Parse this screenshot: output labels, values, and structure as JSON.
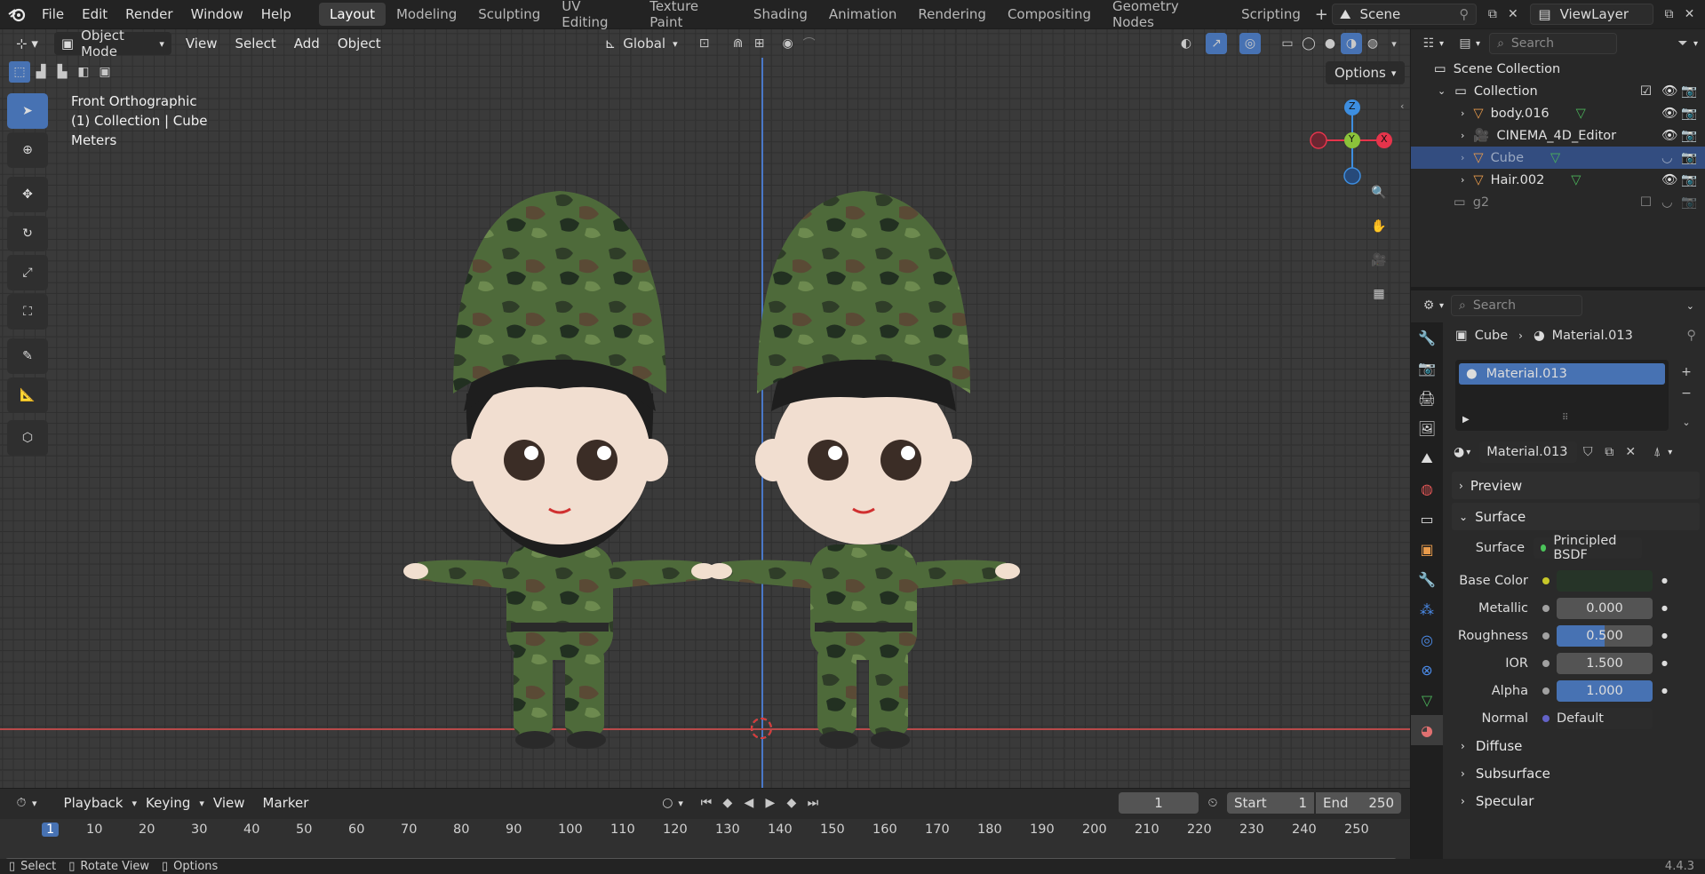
{
  "menu": {
    "file": "File",
    "edit": "Edit",
    "render": "Render",
    "window": "Window",
    "help": "Help"
  },
  "workspaces": [
    "Layout",
    "Modeling",
    "Sculpting",
    "UV Editing",
    "Texture Paint",
    "Shading",
    "Animation",
    "Rendering",
    "Compositing",
    "Geometry Nodes",
    "Scripting"
  ],
  "scene": {
    "label": "Scene",
    "view_layer": "ViewLayer"
  },
  "viewport": {
    "mode": "Object Mode",
    "view": "View",
    "select": "Select",
    "add": "Add",
    "object": "Object",
    "orientation": "Global",
    "options": "Options",
    "overlay_line1": "Front Orthographic",
    "overlay_line2": "(1) Collection | Cube",
    "overlay_line3": "Meters",
    "gizmo": {
      "z": "Z",
      "y": "Y",
      "x": "X"
    }
  },
  "outliner": {
    "search_placeholder": "Search",
    "scene_collection": "Scene Collection",
    "items": [
      {
        "name": "Collection"
      },
      {
        "name": "body.016"
      },
      {
        "name": "CINEMA_4D_Editor"
      },
      {
        "name": "Cube"
      },
      {
        "name": "Hair.002"
      },
      {
        "name": "g2"
      }
    ]
  },
  "properties": {
    "search_placeholder": "Search",
    "breadcrumb_object": "Cube",
    "breadcrumb_material": "Material.013",
    "slot": "Material.013",
    "material_name": "Material.013",
    "sections": {
      "preview": "Preview",
      "surface": "Surface",
      "diffuse": "Diffuse",
      "subsurface": "Subsurface",
      "specular": "Specular"
    },
    "surface_label": "Surface",
    "surface_shader": "Principled BSDF",
    "base_color_label": "Base Color",
    "base_color": "#263428",
    "metallic_label": "Metallic",
    "metallic": "0.000",
    "metallic_value": 0.0,
    "roughness_label": "Roughness",
    "roughness": "0.500",
    "roughness_value": 0.5,
    "ior_label": "IOR",
    "ior": "1.500",
    "ior_value": 0.0,
    "alpha_label": "Alpha",
    "alpha": "1.000",
    "alpha_value": 1.0,
    "normal_label": "Normal",
    "normal": "Default"
  },
  "timeline": {
    "playback": "Playback",
    "keying": "Keying",
    "view": "View",
    "marker": "Marker",
    "current_frame": "1",
    "start_label": "Start",
    "start": "1",
    "end_label": "End",
    "end": "250",
    "ruler": [
      "1",
      "10",
      "20",
      "30",
      "40",
      "50",
      "60",
      "70",
      "80",
      "90",
      "100",
      "110",
      "120",
      "130",
      "140",
      "150",
      "160",
      "170",
      "180",
      "190",
      "200",
      "210",
      "220",
      "230",
      "240",
      "250"
    ]
  },
  "status": {
    "select": "Select",
    "rotate": "Rotate View",
    "options": "Options",
    "version": "4.4.3"
  },
  "colors": {
    "accent": "#4772b3",
    "x_axis": "#e5344b",
    "y_axis": "#8bc33a",
    "z_axis": "#3d8ee0",
    "camo_dark": "#2f3d28",
    "camo_mid": "#4e6a3a",
    "camo_brown": "#5a4a35"
  }
}
